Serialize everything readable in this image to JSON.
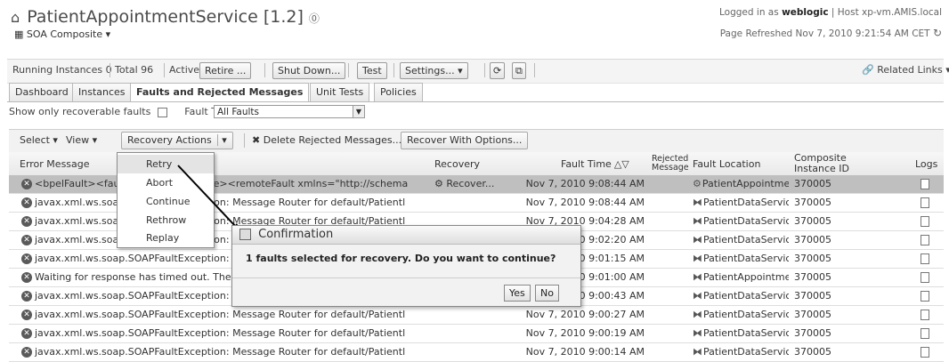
{
  "header": {
    "title": "PatientAppointmentService [1.2]",
    "info_icon": "info-icon",
    "composite_label": "SOA Composite ▾",
    "logged_prefix": "Logged in as",
    "logged_user": "weblogic",
    "host_text": "| Host xp-vm.AMIS.local",
    "refreshed": "Page Refreshed Nov 7, 2010 9:21:54 AM CET"
  },
  "toolbar": {
    "running": "Running Instances 0",
    "total": "Total 96",
    "active": "Active",
    "retire": "Retire ...",
    "shutdown": "Shut Down...",
    "test": "Test",
    "settings": "Settings... ▾",
    "related": "Related Links ▾"
  },
  "tabs": [
    "Dashboard",
    "Instances",
    "Faults and Rejected Messages",
    "Unit Tests",
    "Policies"
  ],
  "filter": {
    "recoverable_label": "Show only recoverable faults",
    "fault_type_label": "Fault Type",
    "fault_type_value": "All Faults"
  },
  "actions": {
    "select": "Select ▾",
    "view": "View ▾",
    "recovery": "Recovery Actions",
    "delete": "Delete Rejected Messages...",
    "recover_options": "Recover With Options..."
  },
  "columns": {
    "error": "Error Message",
    "recovery": "Recovery",
    "fault_time": "Fault Time",
    "rejected": "Rejected Message",
    "location": "Fault Location",
    "instance": "Composite Instance ID",
    "logs": "Logs"
  },
  "rows": [
    {
      "error": "<bpelFault><faultType>0</faultType><remoteFault xmlns=\"http://schema",
      "recovery": "Recover...",
      "time": "Nov 7, 2010 9:08:44 AM",
      "location": "PatientAppointme",
      "instance": "370005"
    },
    {
      "error": "javax.xml.ws.soap.SOAPFaultException: Message Router for default/Patientl",
      "recovery": "",
      "time": "Nov 7, 2010 9:08:44 AM",
      "location": "PatientDataServic",
      "instance": "370005"
    },
    {
      "error": "javax.xml.ws.soap.SOAPFaultException: Message Router for default/Patientl",
      "recovery": "",
      "time": "Nov 7, 2010 9:04:28 AM",
      "location": "PatientDataServic",
      "instance": "370005"
    },
    {
      "error": "javax.xml.ws.soap.SOAPFaultException: Message Router for default/Patientl",
      "recovery": "",
      "time": "Nov 7, 2010 9:02:20 AM",
      "location": "PatientDataServic",
      "instance": "370005"
    },
    {
      "error": "javax.xml.ws.soap.SOAPFaultException: Message Router for default/Patientl",
      "recovery": "",
      "time": "Nov 7, 2010 9:01:15 AM",
      "location": "PatientDataServic",
      "instance": "370005"
    },
    {
      "error": "Waiting for response has timed out. The conversation id is null. Please che",
      "recovery": "",
      "time": "Nov 7, 2010 9:01:00 AM",
      "location": "PatientAppointme",
      "instance": "370005"
    },
    {
      "error": "javax.xml.ws.soap.SOAPFaultException: Message Router for default/Patientl",
      "recovery": "",
      "time": "Nov 7, 2010 9:00:43 AM",
      "location": "PatientDataServic",
      "instance": "370005"
    },
    {
      "error": "javax.xml.ws.soap.SOAPFaultException: Message Router for default/Patientl",
      "recovery": "",
      "time": "Nov 7, 2010 9:00:27 AM",
      "location": "PatientDataServic",
      "instance": "370005"
    },
    {
      "error": "javax.xml.ws.soap.SOAPFaultException: Message Router for default/Patientl",
      "recovery": "",
      "time": "Nov 7, 2010 9:00:19 AM",
      "location": "PatientDataServic",
      "instance": "370005"
    },
    {
      "error": "javax.xml.ws.soap.SOAPFaultException: Message Router for default/Patientl",
      "recovery": "",
      "time": "Nov 7, 2010 9:00:14 AM",
      "location": "PatientDataServic",
      "instance": "370005"
    }
  ],
  "menu": [
    "Retry",
    "Abort",
    "Continue",
    "Rethrow",
    "Replay"
  ],
  "dialog": {
    "title": "Confirmation",
    "message": "1 faults selected for recovery. Do you want to continue?",
    "yes": "Yes",
    "no": "No"
  }
}
